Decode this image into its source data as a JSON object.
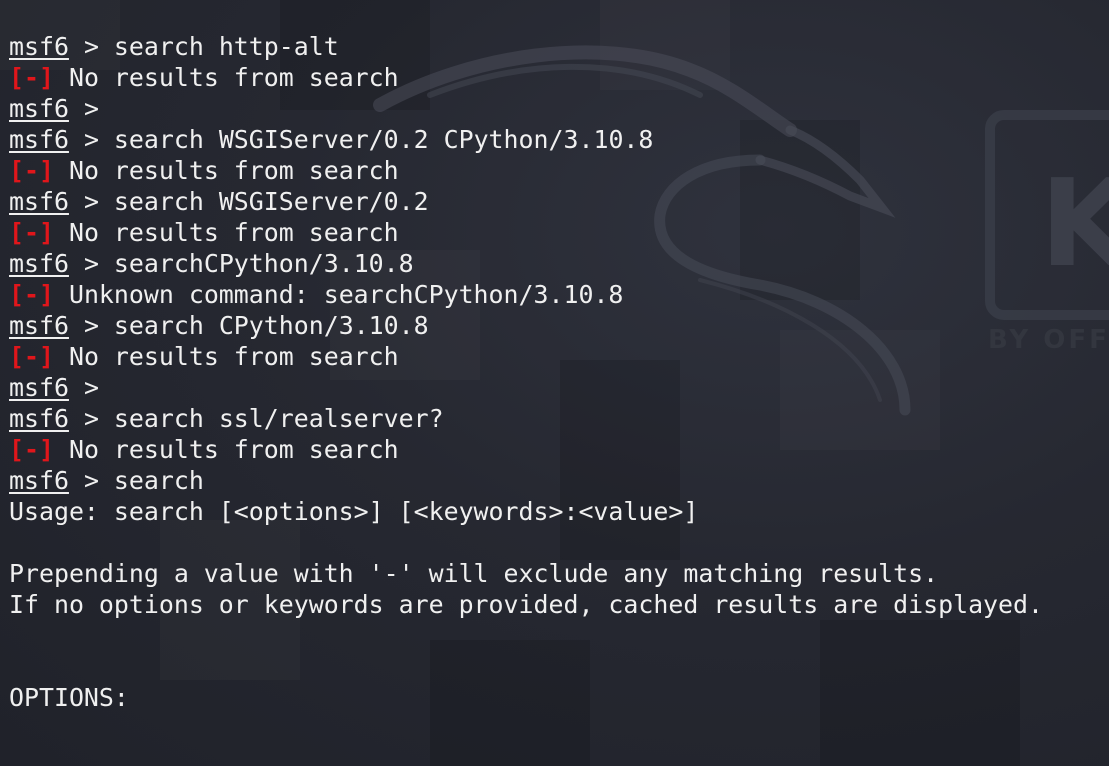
{
  "terminal": {
    "lines": [
      {
        "type": "prompt",
        "prompt": "msf6",
        "sep": " > ",
        "command": "search http-alt"
      },
      {
        "type": "error",
        "tag": "[-]",
        "text": " No results from search"
      },
      {
        "type": "prompt",
        "prompt": "msf6",
        "sep": " > ",
        "command": ""
      },
      {
        "type": "prompt",
        "prompt": "msf6",
        "sep": " > ",
        "command": "search WSGIServer/0.2 CPython/3.10.8"
      },
      {
        "type": "error",
        "tag": "[-]",
        "text": " No results from search"
      },
      {
        "type": "prompt",
        "prompt": "msf6",
        "sep": " > ",
        "command": "search WSGIServer/0.2"
      },
      {
        "type": "error",
        "tag": "[-]",
        "text": " No results from search"
      },
      {
        "type": "prompt",
        "prompt": "msf6",
        "sep": " > ",
        "command": "searchCPython/3.10.8"
      },
      {
        "type": "error",
        "tag": "[-]",
        "text": " Unknown command: searchCPython/3.10.8"
      },
      {
        "type": "prompt",
        "prompt": "msf6",
        "sep": " > ",
        "command": "search CPython/3.10.8"
      },
      {
        "type": "error",
        "tag": "[-]",
        "text": " No results from search"
      },
      {
        "type": "prompt",
        "prompt": "msf6",
        "sep": " > ",
        "command": ""
      },
      {
        "type": "prompt",
        "prompt": "msf6",
        "sep": " > ",
        "command": "search ssl/realserver?"
      },
      {
        "type": "error",
        "tag": "[-]",
        "text": " No results from search"
      },
      {
        "type": "prompt",
        "prompt": "msf6",
        "sep": " > ",
        "command": "search"
      },
      {
        "type": "text",
        "text": "Usage: search [<options>] [<keywords>:<value>]"
      },
      {
        "type": "text",
        "text": ""
      },
      {
        "type": "text",
        "text": "Prepending a value with '-' will exclude any matching results."
      },
      {
        "type": "text",
        "text": "If no options or keywords are provided, cached results are displayed."
      },
      {
        "type": "text",
        "text": ""
      },
      {
        "type": "text",
        "text": ""
      },
      {
        "type": "text",
        "text": "OPTIONS:"
      }
    ]
  },
  "wallpaper": {
    "logo_letter": "K",
    "tagline": "BY OFFE",
    "colors": {
      "background": "#23252e",
      "text": "#f0f0f0",
      "error": "#e0161b"
    }
  }
}
